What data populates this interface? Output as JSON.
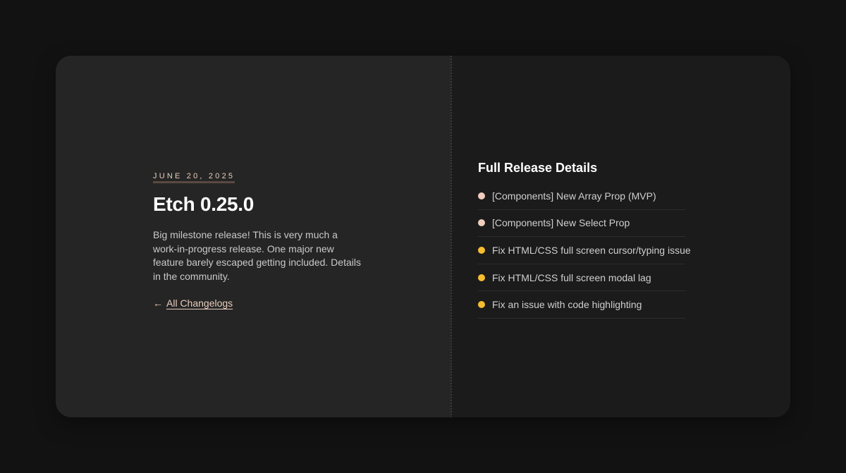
{
  "release": {
    "date": "JUNE 20, 2025",
    "title": "Etch 0.25.0",
    "description": "Big milestone release! This is very much a work-in-progress release. One major new feature barely escaped getting included. Details in the community.",
    "back_arrow": "←",
    "back_link": "All Changelogs"
  },
  "details": {
    "title": "Full Release Details",
    "items": [
      {
        "label": "[Components] New Array Prop (MVP)",
        "type": "feature",
        "color": "#f0cdbd"
      },
      {
        "label": "[Components] New Select Prop",
        "type": "feature",
        "color": "#f0cdbd"
      },
      {
        "label": "Fix HTML/CSS full screen cursor/typing issue",
        "type": "fix",
        "color": "#f6bd2e"
      },
      {
        "label": "Fix HTML/CSS full screen modal lag",
        "type": "fix",
        "color": "#f6bd2e"
      },
      {
        "label": "Fix an issue with code highlighting",
        "type": "fix",
        "color": "#f6bd2e"
      }
    ]
  },
  "colors": {
    "accent": "#e8cdbd",
    "feature_dot": "#f0cdbd",
    "fix_dot": "#f6bd2e",
    "page_bg": "#121212",
    "left_panel": "#252525",
    "right_panel": "#1b1b1b"
  }
}
